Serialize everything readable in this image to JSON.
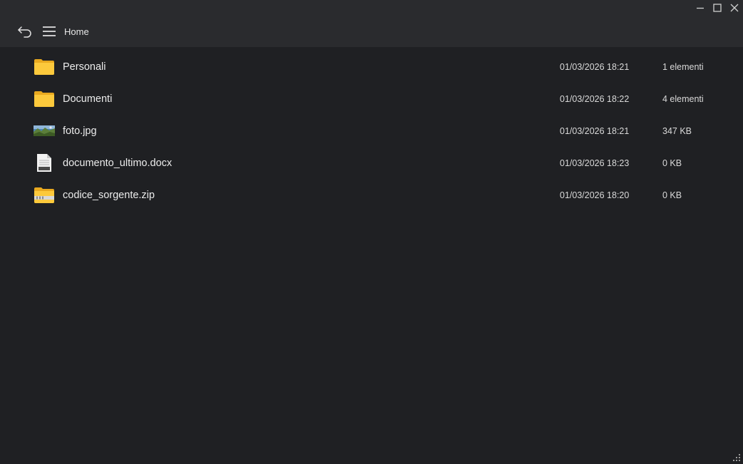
{
  "header": {
    "breadcrumb": "Home",
    "back_icon": "back-arrow-icon",
    "menu_icon": "hamburger-menu-icon"
  },
  "window_controls": {
    "minimize_icon": "minimize-icon",
    "maximize_icon": "maximize-icon",
    "close_icon": "close-icon"
  },
  "files": [
    {
      "name": "Personali",
      "date": "01/03/2026 18:21",
      "size": "1 elementi",
      "icon": "folder-icon"
    },
    {
      "name": "Documenti",
      "date": "01/03/2026 18:22",
      "size": "4 elementi",
      "icon": "folder-icon"
    },
    {
      "name": "foto.jpg",
      "date": "01/03/2026 18:21",
      "size": "347 KB",
      "icon": "image-thumbnail-icon"
    },
    {
      "name": "documento_ultimo.docx",
      "date": "01/03/2026 18:23",
      "size": "0 KB",
      "icon": "docx-file-icon"
    },
    {
      "name": "codice_sorgente.zip",
      "date": "01/03/2026 18:20",
      "size": "0 KB",
      "icon": "zip-folder-icon"
    }
  ],
  "colors": {
    "background": "#1f2023",
    "header": "#2a2b2e",
    "folder": "#f8c83a"
  }
}
